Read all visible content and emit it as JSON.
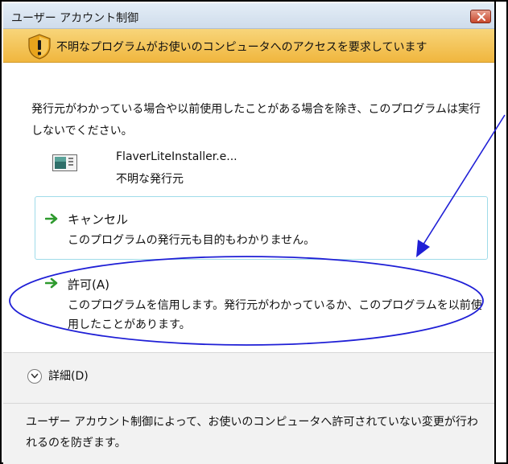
{
  "window": {
    "title": "ユーザー アカウント制御",
    "close_icon": "close-x-icon"
  },
  "warning": {
    "icon": "shield-warning-icon",
    "text": "不明なプログラムがお使いのコンピュータへのアクセスを要求しています"
  },
  "description": "発行元がわかっている場合や以前使用したことがある場合を除き、このプログラムは実行しないでください。",
  "program": {
    "icon": "program-window-icon",
    "filename": "FlaverLiteInstaller.e...",
    "publisher": "不明な発行元"
  },
  "options": [
    {
      "icon": "green-arrow-icon",
      "title": "キャンセル",
      "text": "このプログラムの発行元も目的もわかりません。"
    },
    {
      "icon": "green-arrow-icon",
      "title": "許可(A)",
      "text": "このプログラムを信用します。発行元がわかっているか、このプログラムを以前使用したことがあります。"
    }
  ],
  "details": {
    "icon": "chevron-down-icon",
    "label": "詳細(D)"
  },
  "footer": {
    "text": "ユーザー アカウント制御によって、お使いのコンピュータへ許可されていない変更が行われるのを防ぎます。"
  },
  "colors": {
    "warning_bar": "#f2bd4a",
    "title_bar": "#d8e4f1",
    "highlight_border": "#9fdbe9",
    "annotation": "#1f1fd6",
    "arrow_green": "#2e9a2e"
  }
}
